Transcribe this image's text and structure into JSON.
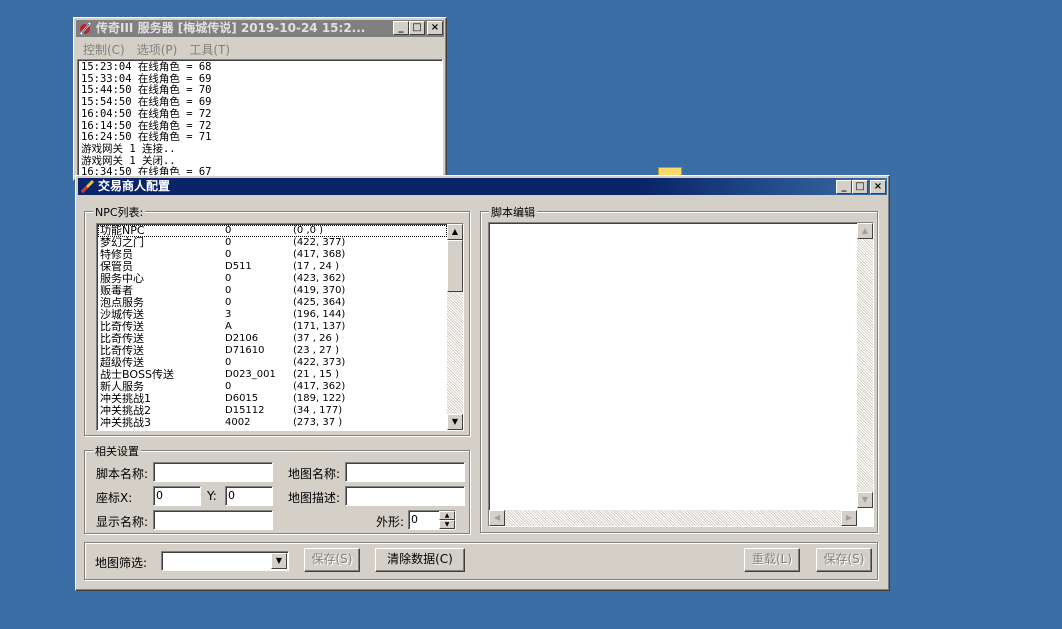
{
  "server_window": {
    "title": "传奇III 服务器 [梅城传说] 2019-10-24 15:2...",
    "menu": [
      "控制(C)",
      "选项(P)",
      "工具(T)"
    ],
    "log_lines": [
      "15:23:04 在线角色 = 68",
      "15:33:04 在线角色 = 69",
      "15:44:50 在线角色 = 70",
      "15:54:50 在线角色 = 69",
      "16:04:50 在线角色 = 72",
      "16:14:50 在线角色 = 72",
      "16:24:50 在线角色 = 71",
      "游戏网关 1 连接..",
      "游戏网关 1 关闭..",
      "16:34:50 在线角色 = 67"
    ]
  },
  "config_window": {
    "title": "交易商人配置",
    "npc_group_label": "NPC列表:",
    "npc_list": [
      {
        "name": "功能NPC",
        "map": "0",
        "coord": "(0  ,0  )"
      },
      {
        "name": "梦幻之门",
        "map": "0",
        "coord": "(422, 377)"
      },
      {
        "name": "特修员",
        "map": "0",
        "coord": "(417, 368)"
      },
      {
        "name": "保管员",
        "map": "D511",
        "coord": "(17 , 24 )"
      },
      {
        "name": "服务中心",
        "map": "0",
        "coord": "(423, 362)"
      },
      {
        "name": "贩毒者",
        "map": "0",
        "coord": "(419, 370)"
      },
      {
        "name": "泡点服务",
        "map": "0",
        "coord": "(425, 364)"
      },
      {
        "name": "沙城传送",
        "map": "3",
        "coord": "(196, 144)"
      },
      {
        "name": "比奇传送",
        "map": "A",
        "coord": "(171, 137)"
      },
      {
        "name": "比奇传送",
        "map": "D2106",
        "coord": "(37 , 26 )"
      },
      {
        "name": "比奇传送",
        "map": "D71610",
        "coord": "(23 , 27 )"
      },
      {
        "name": "超级传送",
        "map": "0",
        "coord": "(422, 373)"
      },
      {
        "name": "战士BOSS传送",
        "map": "D023_001",
        "coord": "(21 , 15 )"
      },
      {
        "name": "新人服务",
        "map": "0",
        "coord": "(417, 362)"
      },
      {
        "name": "冲关挑战1",
        "map": "D6015",
        "coord": "(189, 122)"
      },
      {
        "name": "冲关挑战2",
        "map": "D15112",
        "coord": "(34 , 177)"
      },
      {
        "name": "冲关挑战3",
        "map": "4002",
        "coord": "(273, 37 )"
      }
    ],
    "settings_group_label": "相关设置",
    "script_name_label": "脚本名称:",
    "script_name_value": "",
    "map_name_label": "地图名称:",
    "map_name_value": "",
    "coord_x_label": "座标X:",
    "coord_x_value": "0",
    "coord_y_label": "Y:",
    "coord_y_value": "0",
    "map_desc_label": "地图描述:",
    "map_desc_value": "",
    "display_name_label": "显示名称:",
    "display_name_value": "",
    "appearance_label": "外形:",
    "appearance_value": "0",
    "script_edit_label": "脚本编辑",
    "map_filter_label": "地图筛选:",
    "map_filter_value": "",
    "save_button": "保存(S)",
    "clear_button": "清除数据(C)",
    "reload_button": "重载(L)",
    "save_script_button": "保存(S)"
  }
}
